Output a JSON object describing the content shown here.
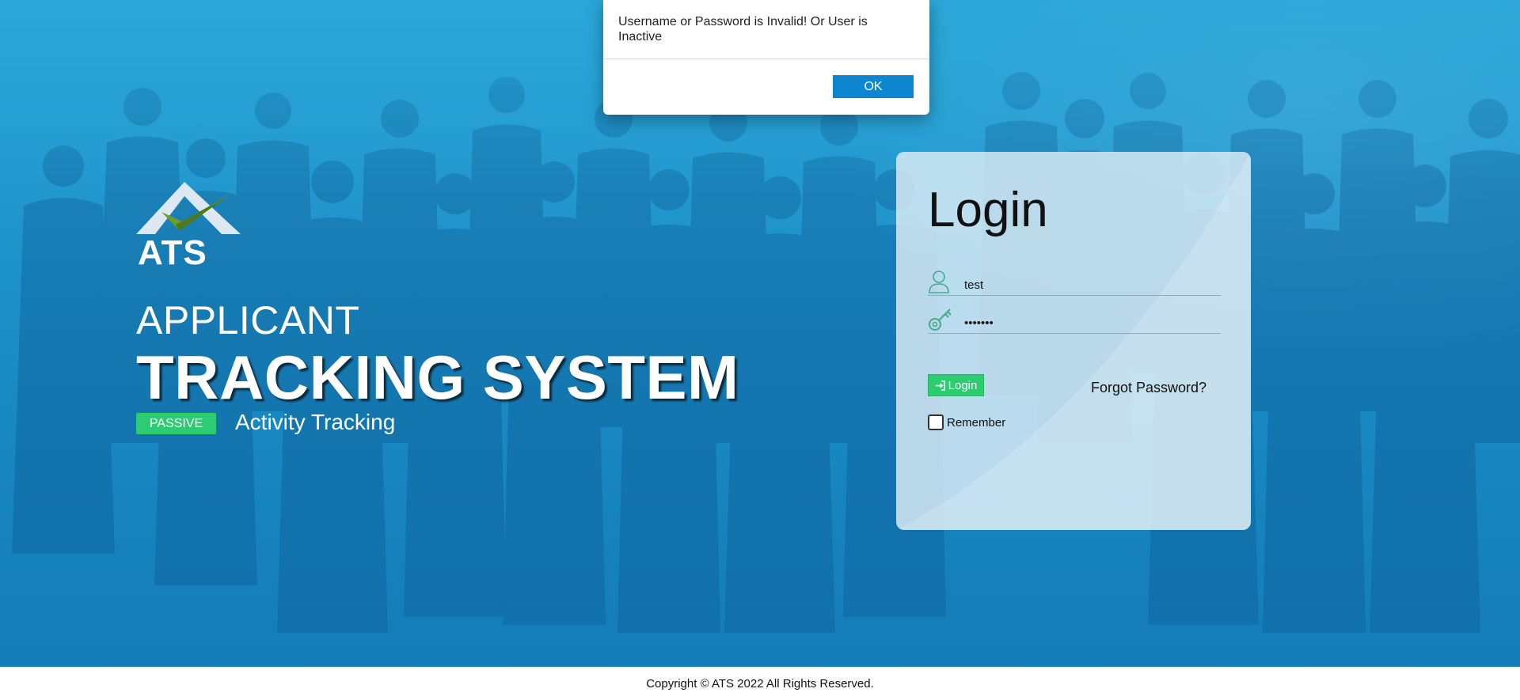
{
  "brand": {
    "logo_text": "ATS",
    "title_line1": "APPLICANT",
    "title_line2": "TRACKING SYSTEM",
    "tag": "PASSIVE",
    "tagline": "Activity Tracking",
    "colors": {
      "primary": "#1b8ec7",
      "accent_green": "#2ecc71",
      "ok_button": "#0e86cf"
    }
  },
  "login": {
    "title": "Login",
    "username_value": "test",
    "password_value": "•••••••",
    "username_icon": "user-icon",
    "password_icon": "key-icon",
    "submit_label": "Login",
    "submit_icon": "sign-in-icon",
    "forgot_label": "Forgot Password?",
    "remember_label": "Remember",
    "remember_checked": false
  },
  "alert": {
    "message": "Username or Password is Invalid! Or User is Inactive",
    "ok_label": "OK"
  },
  "footer": {
    "copyright": "Copyright © ATS 2022 All Rights Reserved."
  }
}
